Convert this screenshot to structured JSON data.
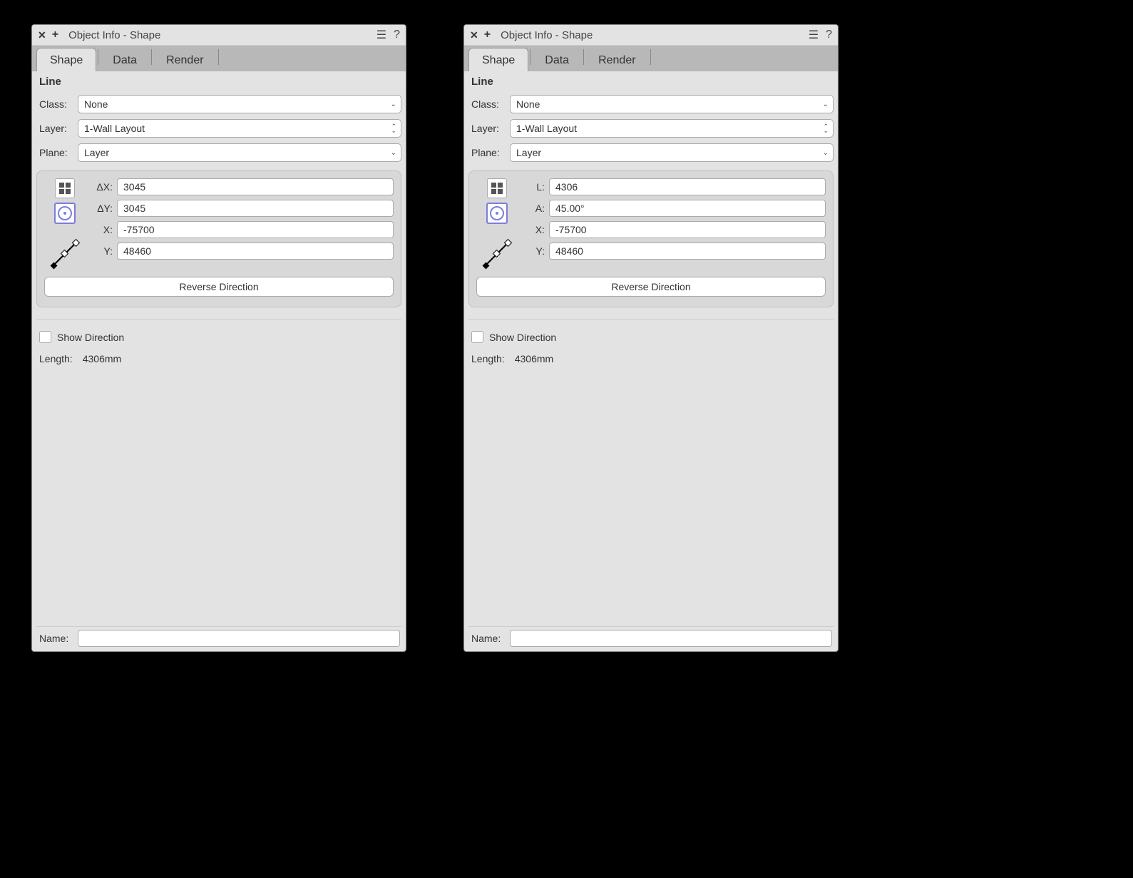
{
  "left": {
    "window_title": "Object Info - Shape",
    "tabs": [
      "Shape",
      "Data",
      "Render"
    ],
    "active_tab": 0,
    "object_type": "Line",
    "class_label": "Class:",
    "class_value": "None",
    "layer_label": "Layer:",
    "layer_value": "1-Wall Layout",
    "plane_label": "Plane:",
    "plane_value": "Layer",
    "selected_mode": "grid",
    "coords": [
      {
        "label": "ΔX:",
        "value": "3045"
      },
      {
        "label": "ΔY:",
        "value": "3045"
      },
      {
        "label": "X:",
        "value": "-75700"
      },
      {
        "label": "Y:",
        "value": "48460"
      }
    ],
    "reverse_btn": "Reverse Direction",
    "show_direction_label": "Show Direction",
    "show_direction_checked": false,
    "length_label": "Length:",
    "length_value": "4306mm",
    "name_label": "Name:",
    "name_value": ""
  },
  "right": {
    "window_title": "Object Info - Shape",
    "tabs": [
      "Shape",
      "Data",
      "Render"
    ],
    "active_tab": 0,
    "object_type": "Line",
    "class_label": "Class:",
    "class_value": "None",
    "layer_label": "Layer:",
    "layer_value": "1-Wall Layout",
    "plane_label": "Plane:",
    "plane_value": "Layer",
    "selected_mode": "polar",
    "coords": [
      {
        "label": "L:",
        "value": "4306"
      },
      {
        "label": "A:",
        "value": "45.00°"
      },
      {
        "label": "X:",
        "value": "-75700"
      },
      {
        "label": "Y:",
        "value": "48460"
      }
    ],
    "reverse_btn": "Reverse Direction",
    "show_direction_label": "Show Direction",
    "show_direction_checked": false,
    "length_label": "Length:",
    "length_value": "4306mm",
    "name_label": "Name:",
    "name_value": ""
  }
}
